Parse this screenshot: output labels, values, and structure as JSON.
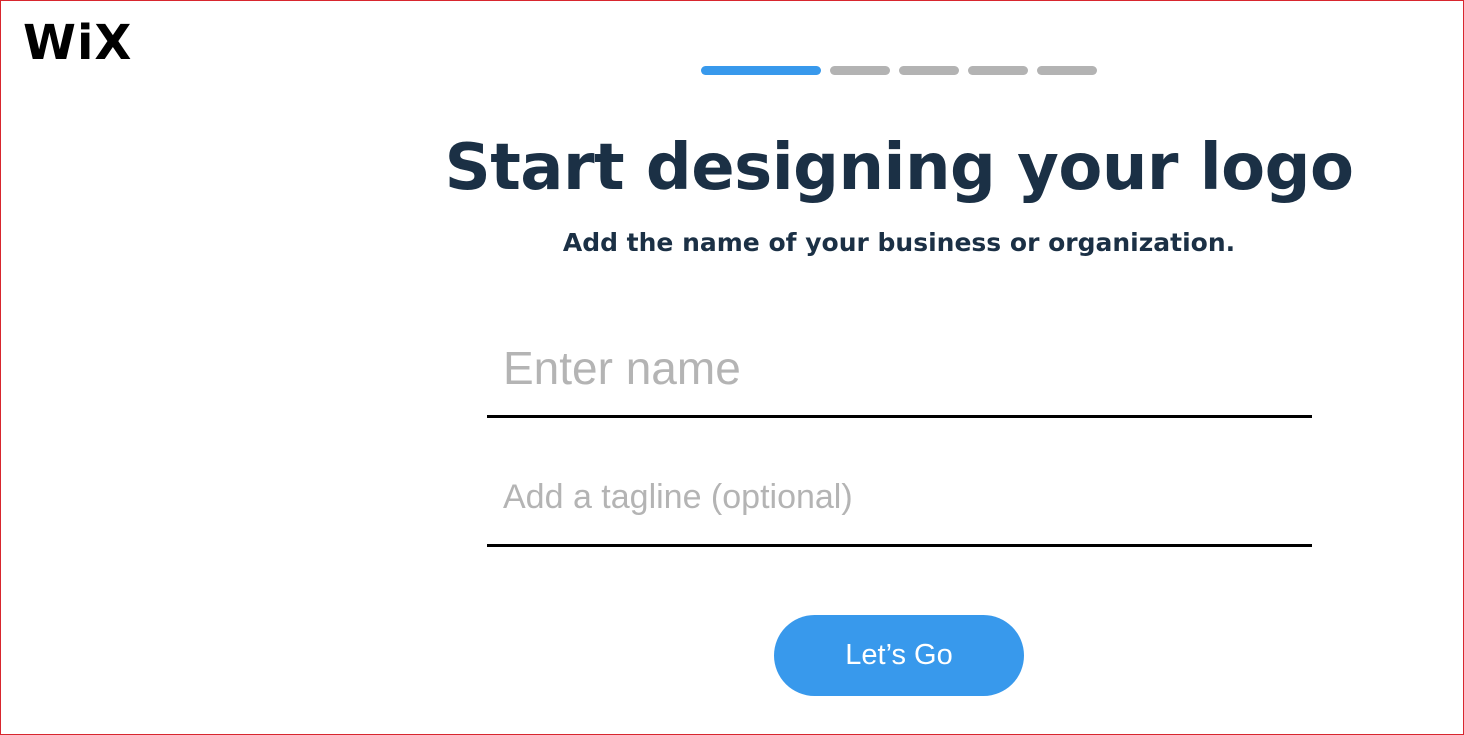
{
  "brand": {
    "logo_text": "WiX"
  },
  "progress": {
    "current_step": 1,
    "total_steps": 5,
    "active_color": "#3899ec",
    "inactive_color": "#b3b3b3"
  },
  "heading": {
    "title": "Start designing your logo",
    "subtitle": "Add the name of your business or organization.",
    "color": "#1b3045"
  },
  "form": {
    "name_field": {
      "value": "",
      "placeholder": "Enter name"
    },
    "tagline_field": {
      "value": "",
      "placeholder": "Add a tagline (optional)"
    },
    "submit_label": "Let’s Go",
    "submit_color": "#3899ec"
  }
}
